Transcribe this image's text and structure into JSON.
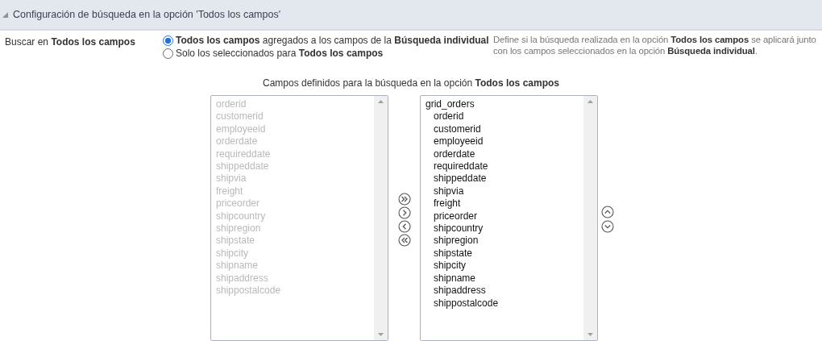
{
  "section": {
    "title": "Configuración de búsqueda en la opción 'Todos los campos'",
    "expanded": true
  },
  "setting": {
    "label": "Buscar en **Todos los campos**",
    "options": [
      {
        "label": "**Todos los campos** agregados a los campos de la **Búsqueda individual**",
        "selected": true
      },
      {
        "label": "Solo los seleccionados para **Todos los campos**",
        "selected": false
      }
    ],
    "help": "Define si la búsqueda realizada en la opción **Todos los campos** se aplicará junto con los campos seleccionados en la opción **Búsqueda individual**."
  },
  "fields_caption": "Campos definidos para la búsqueda en la opción **Todos los campos**",
  "available_fields": [
    {
      "label": "orderid",
      "disabled": true
    },
    {
      "label": "customerid",
      "disabled": true
    },
    {
      "label": "employeeid",
      "disabled": true
    },
    {
      "label": "orderdate",
      "disabled": true
    },
    {
      "label": "requireddate",
      "disabled": true
    },
    {
      "label": "shippeddate",
      "disabled": true
    },
    {
      "label": "shipvia",
      "disabled": true
    },
    {
      "label": "freight",
      "disabled": true
    },
    {
      "label": "priceorder",
      "disabled": true
    },
    {
      "label": "shipcountry",
      "disabled": true
    },
    {
      "label": "shipregion",
      "disabled": true
    },
    {
      "label": "shipstate",
      "disabled": true
    },
    {
      "label": "shipcity",
      "disabled": true
    },
    {
      "label": "shipname",
      "disabled": true
    },
    {
      "label": "shipaddress",
      "disabled": true
    },
    {
      "label": "shippostalcode",
      "disabled": true
    }
  ],
  "selected_fields": [
    {
      "label": "grid_orders",
      "children": [
        {
          "label": "orderid"
        },
        {
          "label": "customerid"
        },
        {
          "label": "employeeid"
        },
        {
          "label": "orderdate"
        },
        {
          "label": "requireddate"
        },
        {
          "label": "shippeddate"
        },
        {
          "label": "shipvia"
        },
        {
          "label": "freight"
        },
        {
          "label": "priceorder"
        },
        {
          "label": "shipcountry"
        },
        {
          "label": "shipregion"
        },
        {
          "label": "shipstate"
        },
        {
          "label": "shipcity"
        },
        {
          "label": "shipname"
        },
        {
          "label": "shipaddress"
        },
        {
          "label": "shippostalcode"
        }
      ]
    }
  ]
}
